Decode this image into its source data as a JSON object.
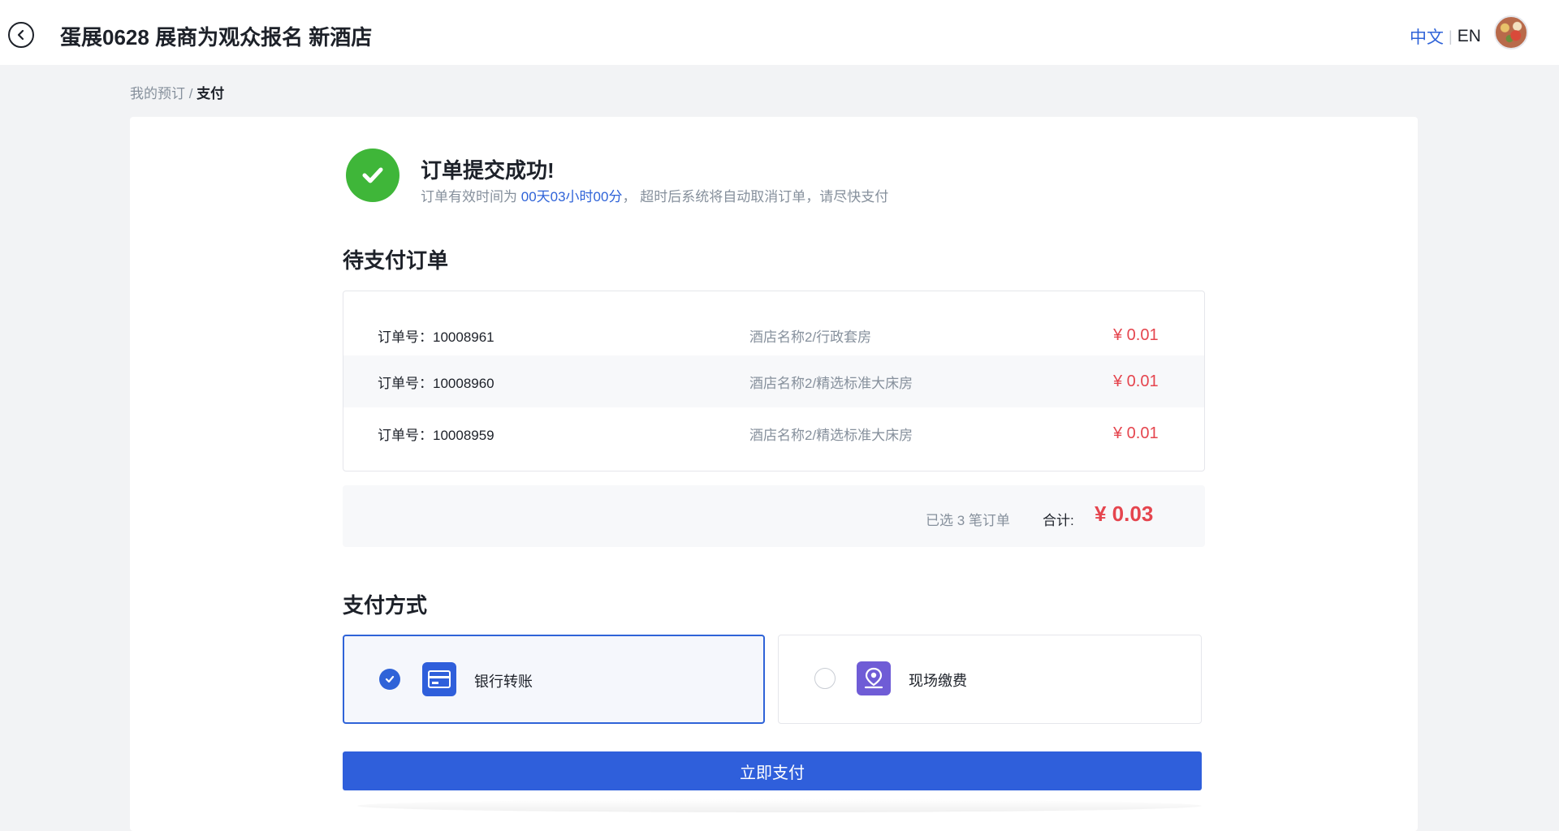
{
  "header": {
    "title": "蛋展0628 展商为观众报名 新酒店",
    "lang_zh": "中文",
    "lang_sep": "|",
    "lang_en": "EN"
  },
  "breadcrumb": {
    "parent": "我的预订",
    "separator": " / ",
    "current": "支付"
  },
  "success": {
    "title": "订单提交成功!",
    "sub_prefix": "订单有效时间为 ",
    "time_left": "00天03小时00分",
    "sub_suffix": "， 超时后系统将自动取消订单，请尽快支付"
  },
  "pending": {
    "title": "待支付订单",
    "orders": [
      {
        "no": "订单号：10008961",
        "hotel": "酒店名称2/行政套房",
        "price": "¥ 0.01"
      },
      {
        "no": "订单号：10008960",
        "hotel": "酒店名称2/精选标准大床房",
        "price": "¥ 0.01"
      },
      {
        "no": "订单号：10008959",
        "hotel": "酒店名称2/精选标准大床房",
        "price": "¥ 0.01"
      }
    ],
    "selected_text": "已选 3 笔订单",
    "total_label": "合计:",
    "total": "¥ 0.03"
  },
  "payment": {
    "title": "支付方式",
    "options": [
      {
        "label": "银行转账",
        "icon": "bank-card-icon",
        "selected": true
      },
      {
        "label": "现场缴费",
        "icon": "location-person-icon",
        "selected": false
      }
    ],
    "pay_button": "立即支付"
  },
  "colors": {
    "accent": "#2f5fdb",
    "price": "#e5454e",
    "success": "#3fb639",
    "onsite_icon": "#6f5cd6"
  }
}
